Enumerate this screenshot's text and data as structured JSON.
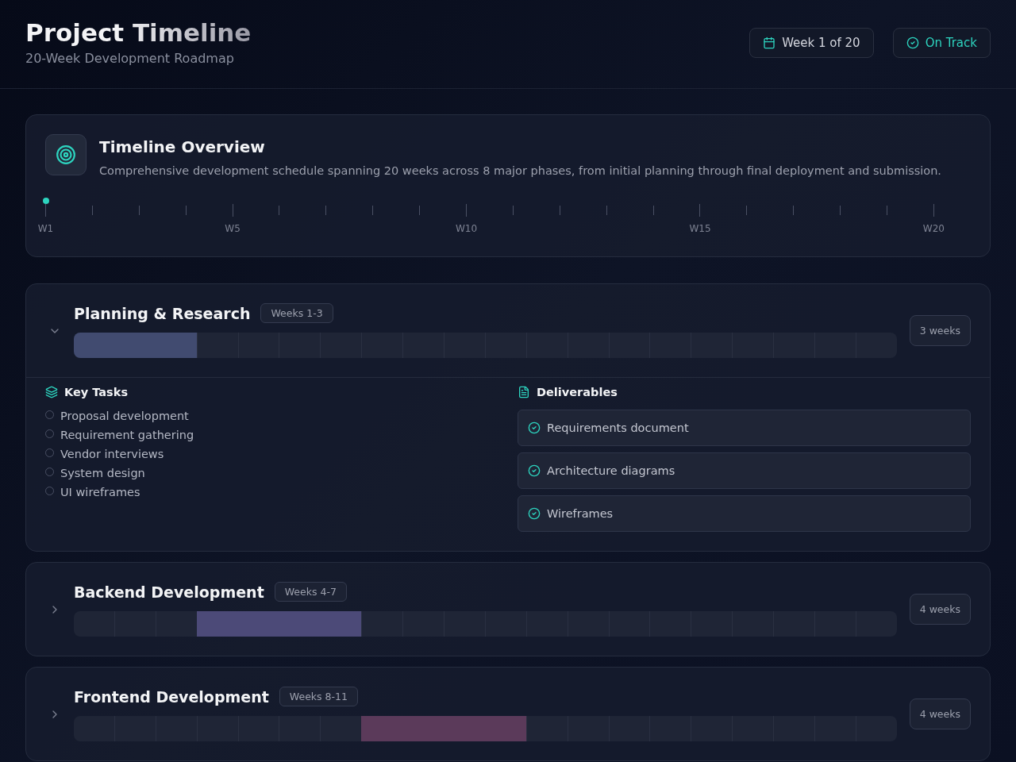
{
  "header": {
    "title": "Project Timeline",
    "subtitle": "20-Week Development Roadmap",
    "week_badge": "Week 1 of 20",
    "status_badge": "On Track"
  },
  "overview": {
    "title": "Timeline Overview",
    "description": "Comprehensive development schedule spanning 20 weeks across 8 major phases, from initial planning through final deployment and submission.",
    "weeks": [
      {
        "label": "W1",
        "current": true
      },
      {
        "current": false
      },
      {
        "current": false
      },
      {
        "current": false
      },
      {
        "label": "W5",
        "current": false
      },
      {
        "current": false
      },
      {
        "current": false
      },
      {
        "current": false
      },
      {
        "current": false
      },
      {
        "label": "W10",
        "current": false
      },
      {
        "current": false
      },
      {
        "current": false
      },
      {
        "current": false
      },
      {
        "current": false
      },
      {
        "label": "W15",
        "current": false
      },
      {
        "current": false
      },
      {
        "current": false
      },
      {
        "current": false
      },
      {
        "current": false
      },
      {
        "label": "W20",
        "current": false
      }
    ]
  },
  "phases": [
    {
      "title": "Planning & Research",
      "weeks_label": "Weeks 1-3",
      "duration": "3 weeks",
      "expanded": true,
      "color": "#414b70",
      "active_weeks": [
        true,
        true,
        true,
        false,
        false,
        false,
        false,
        false,
        false,
        false,
        false,
        false,
        false,
        false,
        false,
        false,
        false,
        false,
        false,
        false
      ],
      "tasks_title": "Key Tasks",
      "tasks": [
        "Proposal development",
        "Requirement gathering",
        "Vendor interviews",
        "System design",
        "UI wireframes"
      ],
      "deliverables_title": "Deliverables",
      "deliverables": [
        "Requirements document",
        "Architecture diagrams",
        "Wireframes"
      ]
    },
    {
      "title": "Backend Development",
      "weeks_label": "Weeks 4-7",
      "duration": "4 weeks",
      "expanded": false,
      "color": "#4c4a78",
      "active_weeks": [
        false,
        false,
        false,
        true,
        true,
        true,
        true,
        false,
        false,
        false,
        false,
        false,
        false,
        false,
        false,
        false,
        false,
        false,
        false,
        false
      ]
    },
    {
      "title": "Frontend Development",
      "weeks_label": "Weeks 8-11",
      "duration": "4 weeks",
      "expanded": false,
      "color": "#5b3a5a",
      "active_weeks": [
        false,
        false,
        false,
        false,
        false,
        false,
        false,
        true,
        true,
        true,
        true,
        false,
        false,
        false,
        false,
        false,
        false,
        false,
        false,
        false
      ]
    }
  ]
}
